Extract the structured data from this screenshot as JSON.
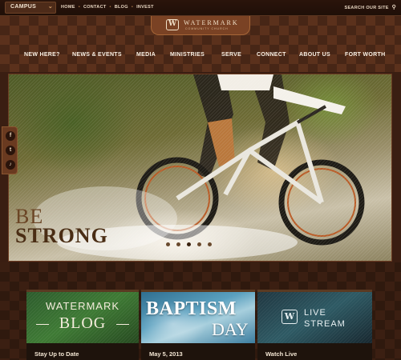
{
  "topbar": {
    "campus_label": "CAMPUS",
    "links": [
      "HOME",
      "CONTACT",
      "BLOG",
      "INVEST"
    ],
    "search_label": "SEARCH OUR SITE"
  },
  "logo": {
    "mark": "W",
    "name": "WATERMARK",
    "sub": "COMMUNITY CHURCH"
  },
  "nav": {
    "items": [
      "NEW HERE?",
      "NEWS & EVENTS",
      "MEDIA",
      "MINISTRIES",
      "SERVE",
      "CONNECT",
      "ABOUT US",
      "FORT WORTH"
    ]
  },
  "hero": {
    "title_line1": "BE",
    "title_line2": "STRONG",
    "slide_count": 5,
    "active_slide": 2
  },
  "social": {
    "icons": [
      "facebook-icon",
      "twitter-icon",
      "podcast-icon"
    ],
    "glyphs": [
      "f",
      "t",
      "♪"
    ]
  },
  "cards": [
    {
      "line1": "WATERMARK",
      "line2": "BLOG",
      "footer": "Stay Up to Date"
    },
    {
      "line1": "BAPTISM",
      "line2": "DAY",
      "footer": "May 5, 2013"
    },
    {
      "mark": "W",
      "line1": "LIVE",
      "line2": "STREAM",
      "footer": "Watch Live"
    }
  ],
  "colors": {
    "brand_brown": "#5b311c",
    "dark_brown": "#3b1f12",
    "cream": "#f0e0c8"
  }
}
